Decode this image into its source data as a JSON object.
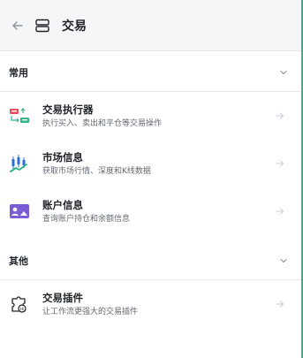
{
  "header": {
    "title": "交易"
  },
  "sections": [
    {
      "title": "常用",
      "items": [
        {
          "title": "交易执行器",
          "desc": "执行买入、卖出和平仓等交易操作",
          "icon": "trade-executor-icon"
        },
        {
          "title": "市场信息",
          "desc": "获取市场行情、深度和K线数据",
          "icon": "market-chart-icon"
        },
        {
          "title": "账户信息",
          "desc": "查询账户持仓和余额信息",
          "icon": "account-card-icon"
        }
      ]
    },
    {
      "title": "其他",
      "items": [
        {
          "title": "交易插件",
          "desc": "让工作流更强大的交易插件",
          "icon": "plugin-puzzle-icon"
        }
      ]
    }
  ],
  "colors": {
    "accent": "#34b489",
    "header_bg": "#f5f6f7",
    "muted": "#8f959e"
  }
}
